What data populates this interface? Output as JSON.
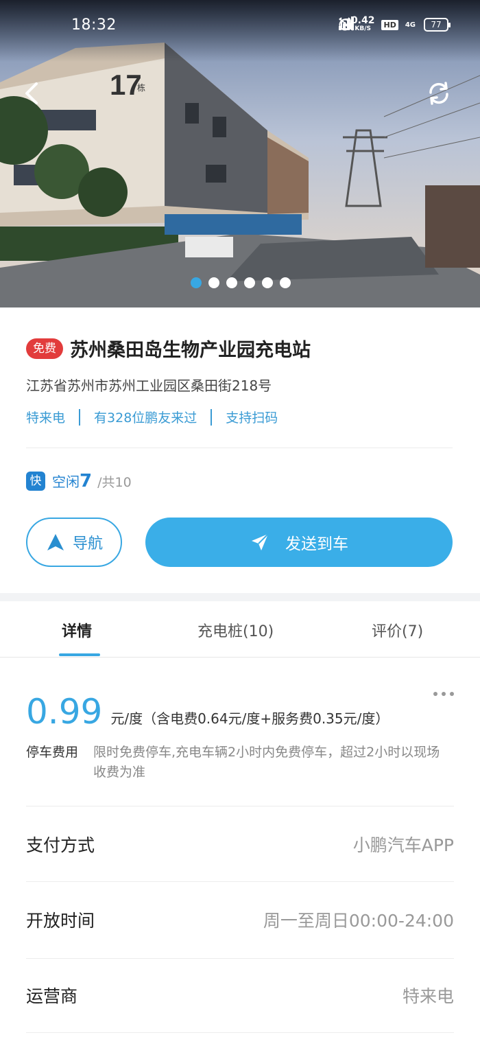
{
  "status_bar": {
    "time": "18:32",
    "speed_value": "0.42",
    "speed_unit": "KB/S",
    "hd": "HD",
    "network": "4G",
    "battery": "77"
  },
  "hero": {
    "building_label": "17",
    "building_suffix": "栋",
    "slides_total": 6,
    "active_slide": 1
  },
  "station": {
    "badge": "免费",
    "name": "苏州桑田岛生物产业园充电站",
    "address": "江苏省苏州市苏州工业园区桑田街218号",
    "tags": [
      "特来电",
      "有328位鹏友来过",
      "支持扫码"
    ]
  },
  "availability": {
    "fast_badge": "快",
    "idle_label": "空闲",
    "idle_count": "7",
    "total": "/共10"
  },
  "actions": {
    "navigate_label": "导航",
    "send_label": "发送到车"
  },
  "tabs": [
    {
      "label": "详情"
    },
    {
      "label": "充电桩(10)"
    },
    {
      "label": "评价(7)"
    }
  ],
  "details": {
    "price": "0.99",
    "price_detail": "元/度（含电费0.64元/度+服务费0.35元/度）",
    "parking_label": "停车费用",
    "parking_text": "限时免费停车,充电车辆2小时内免费停车，超过2小时以现场收费为准",
    "rows": [
      {
        "label": "支付方式",
        "value": "小鹏汽车APP"
      },
      {
        "label": "开放时间",
        "value": "周一至周日00:00-24:00"
      },
      {
        "label": "运营商",
        "value": "特来电"
      }
    ]
  },
  "colors": {
    "accent": "#38a7e2",
    "free_badge": "#e23c3c",
    "fast_badge": "#2383d1"
  }
}
